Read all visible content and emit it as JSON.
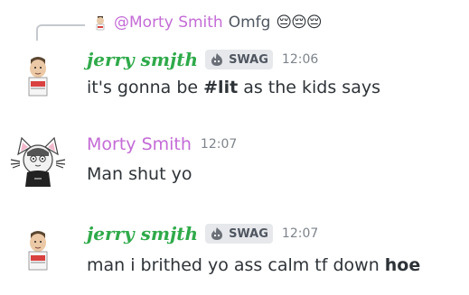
{
  "reply": {
    "author": "@Morty Smith",
    "text": "Omfg",
    "emojis": "😔😔😔"
  },
  "messages": [
    {
      "author": "jerry smjth",
      "tag": "SWAG",
      "time": "12:06",
      "text_before": "it's gonna be ",
      "text_bold": "#lit",
      "text_after": " as the kids says"
    },
    {
      "author": "Morty Smith",
      "time": "12:07",
      "text": "Man shut yo"
    },
    {
      "author": "jerry smjth",
      "tag": "SWAG",
      "time": "12:07",
      "text_before": "man i brithed yo ass calm tf down ",
      "text_bold": "hoe"
    }
  ]
}
